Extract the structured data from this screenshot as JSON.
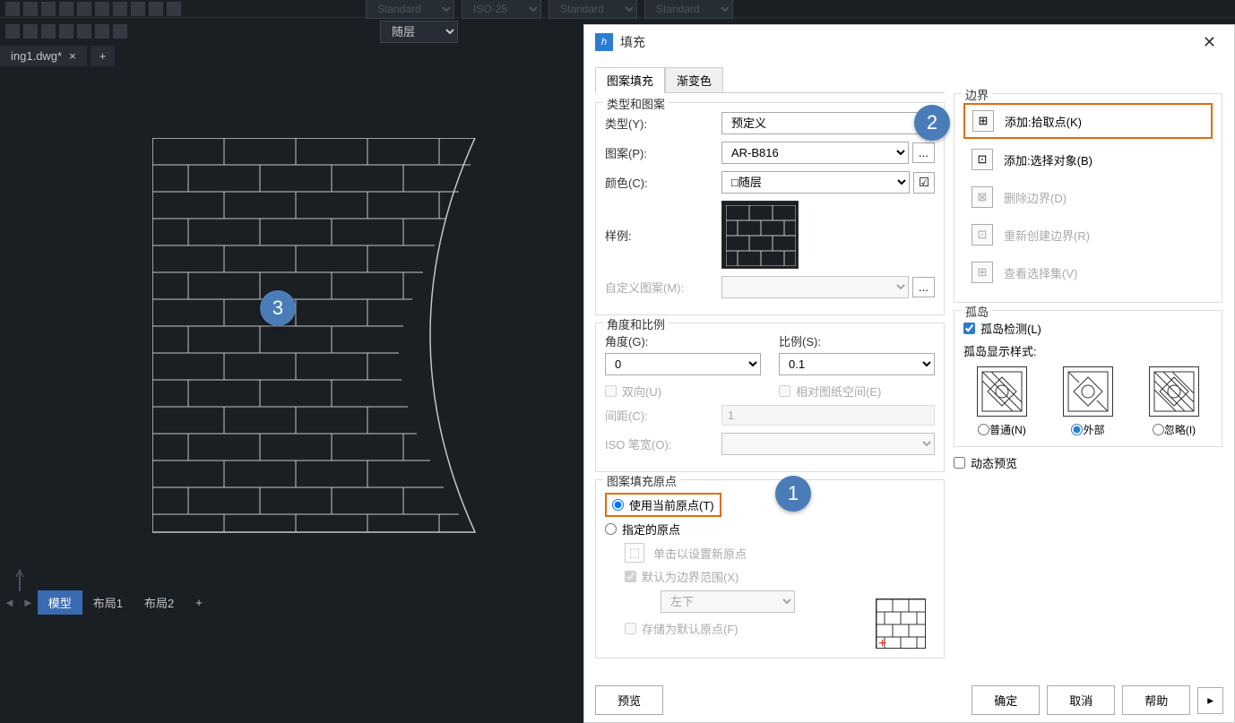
{
  "toolbar": {
    "layer": "随层",
    "std1": "Standard",
    "iso": "ISO-25",
    "std2": "Standard",
    "std3": "Standard"
  },
  "tabs": {
    "file": "ing1.dwg*",
    "model": "模型",
    "layout1": "布局1",
    "layout2": "布局2"
  },
  "badges": {
    "b1": "1",
    "b2": "2",
    "b3": "3"
  },
  "dialog": {
    "title": "填充",
    "tab_pattern": "图案填充",
    "tab_gradient": "渐变色",
    "group_type": "类型和图案",
    "label_type": "类型(Y):",
    "type_value": "预定义",
    "label_pattern": "图案(P):",
    "pattern_value": "AR-B816",
    "label_color": "颜色(C):",
    "color_value": "□随层",
    "label_sample": "样例:",
    "label_custom": "自定义图案(M):",
    "group_angle": "角度和比例",
    "label_angle": "角度(G):",
    "angle_value": "0",
    "label_scale": "比例(S):",
    "scale_value": "0.1",
    "cb_double": "双向(U)",
    "cb_relative": "相对图纸空间(E)",
    "label_spacing": "间距(C):",
    "spacing_value": "1",
    "label_isowidth": "ISO 笔宽(O):",
    "group_origin": "图案填充原点",
    "rb_current": "使用当前原点(T)",
    "rb_specified": "指定的原点",
    "btn_clickset": "单击以设置新原点",
    "cb_default_extent": "默认为边界范围(X)",
    "extent_pos": "左下",
    "cb_store_default": "存储为默认原点(F)",
    "group_boundary": "边界",
    "btn_add_pick": "添加:拾取点(K)",
    "btn_add_select": "添加:选择对象(B)",
    "btn_del_boundary": "删除边界(D)",
    "btn_recreate": "重新创建边界(R)",
    "btn_view_sel": "查看选择集(V)",
    "group_island": "孤岛",
    "cb_island_detect": "孤岛检测(L)",
    "label_island_style": "孤岛显示样式:",
    "island_normal": "普通(N)",
    "island_outer": "外部",
    "island_ignore": "忽略(I)",
    "cb_dynamic": "动态预览",
    "btn_preview": "预览",
    "btn_ok": "确定",
    "btn_cancel": "取消",
    "btn_help": "帮助"
  }
}
